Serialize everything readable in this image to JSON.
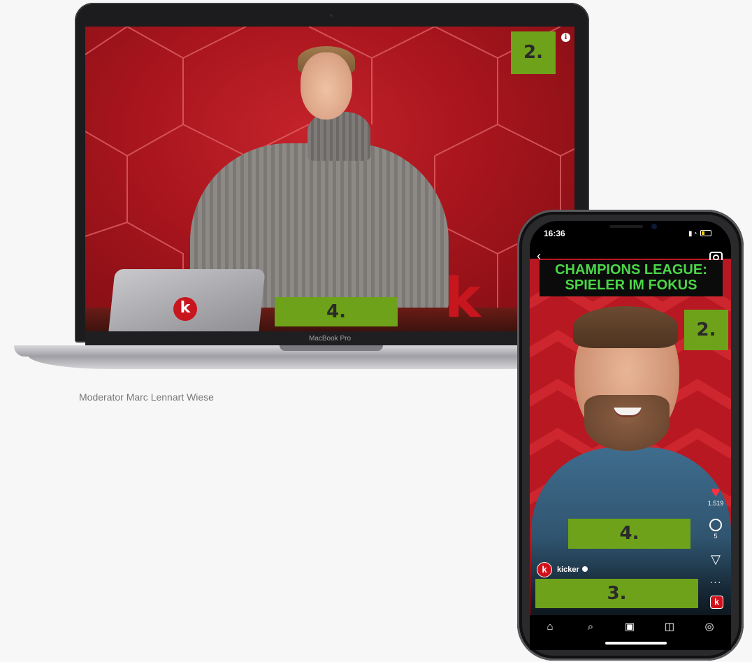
{
  "caption": "Moderator Marc Lennart Wiese",
  "laptop": {
    "chin_label": "MacBook Pro",
    "info_icon": "info-icon",
    "tag_top": "2.",
    "tag_bottom": "4.",
    "k_logo": "k",
    "k_letter": "k"
  },
  "phone": {
    "status_time": "16:36",
    "headline_line1": "CHAMPIONS LEAGUE:",
    "headline_line2": "SPIELER IM FOKUS",
    "tag_right": "2.",
    "tag_middle": "4.",
    "tag_bottom": "3.",
    "likes_count": "1.519",
    "comments_count": "5",
    "account_name": "kicker",
    "profile_initial": "k",
    "badge_initial": "k",
    "accent_color": "#6ea21a",
    "brand_color": "#d0111b",
    "headline_color": "#4bd648",
    "nav": [
      "home-icon",
      "search-icon",
      "reels-icon",
      "shop-icon",
      "profile-icon"
    ]
  }
}
